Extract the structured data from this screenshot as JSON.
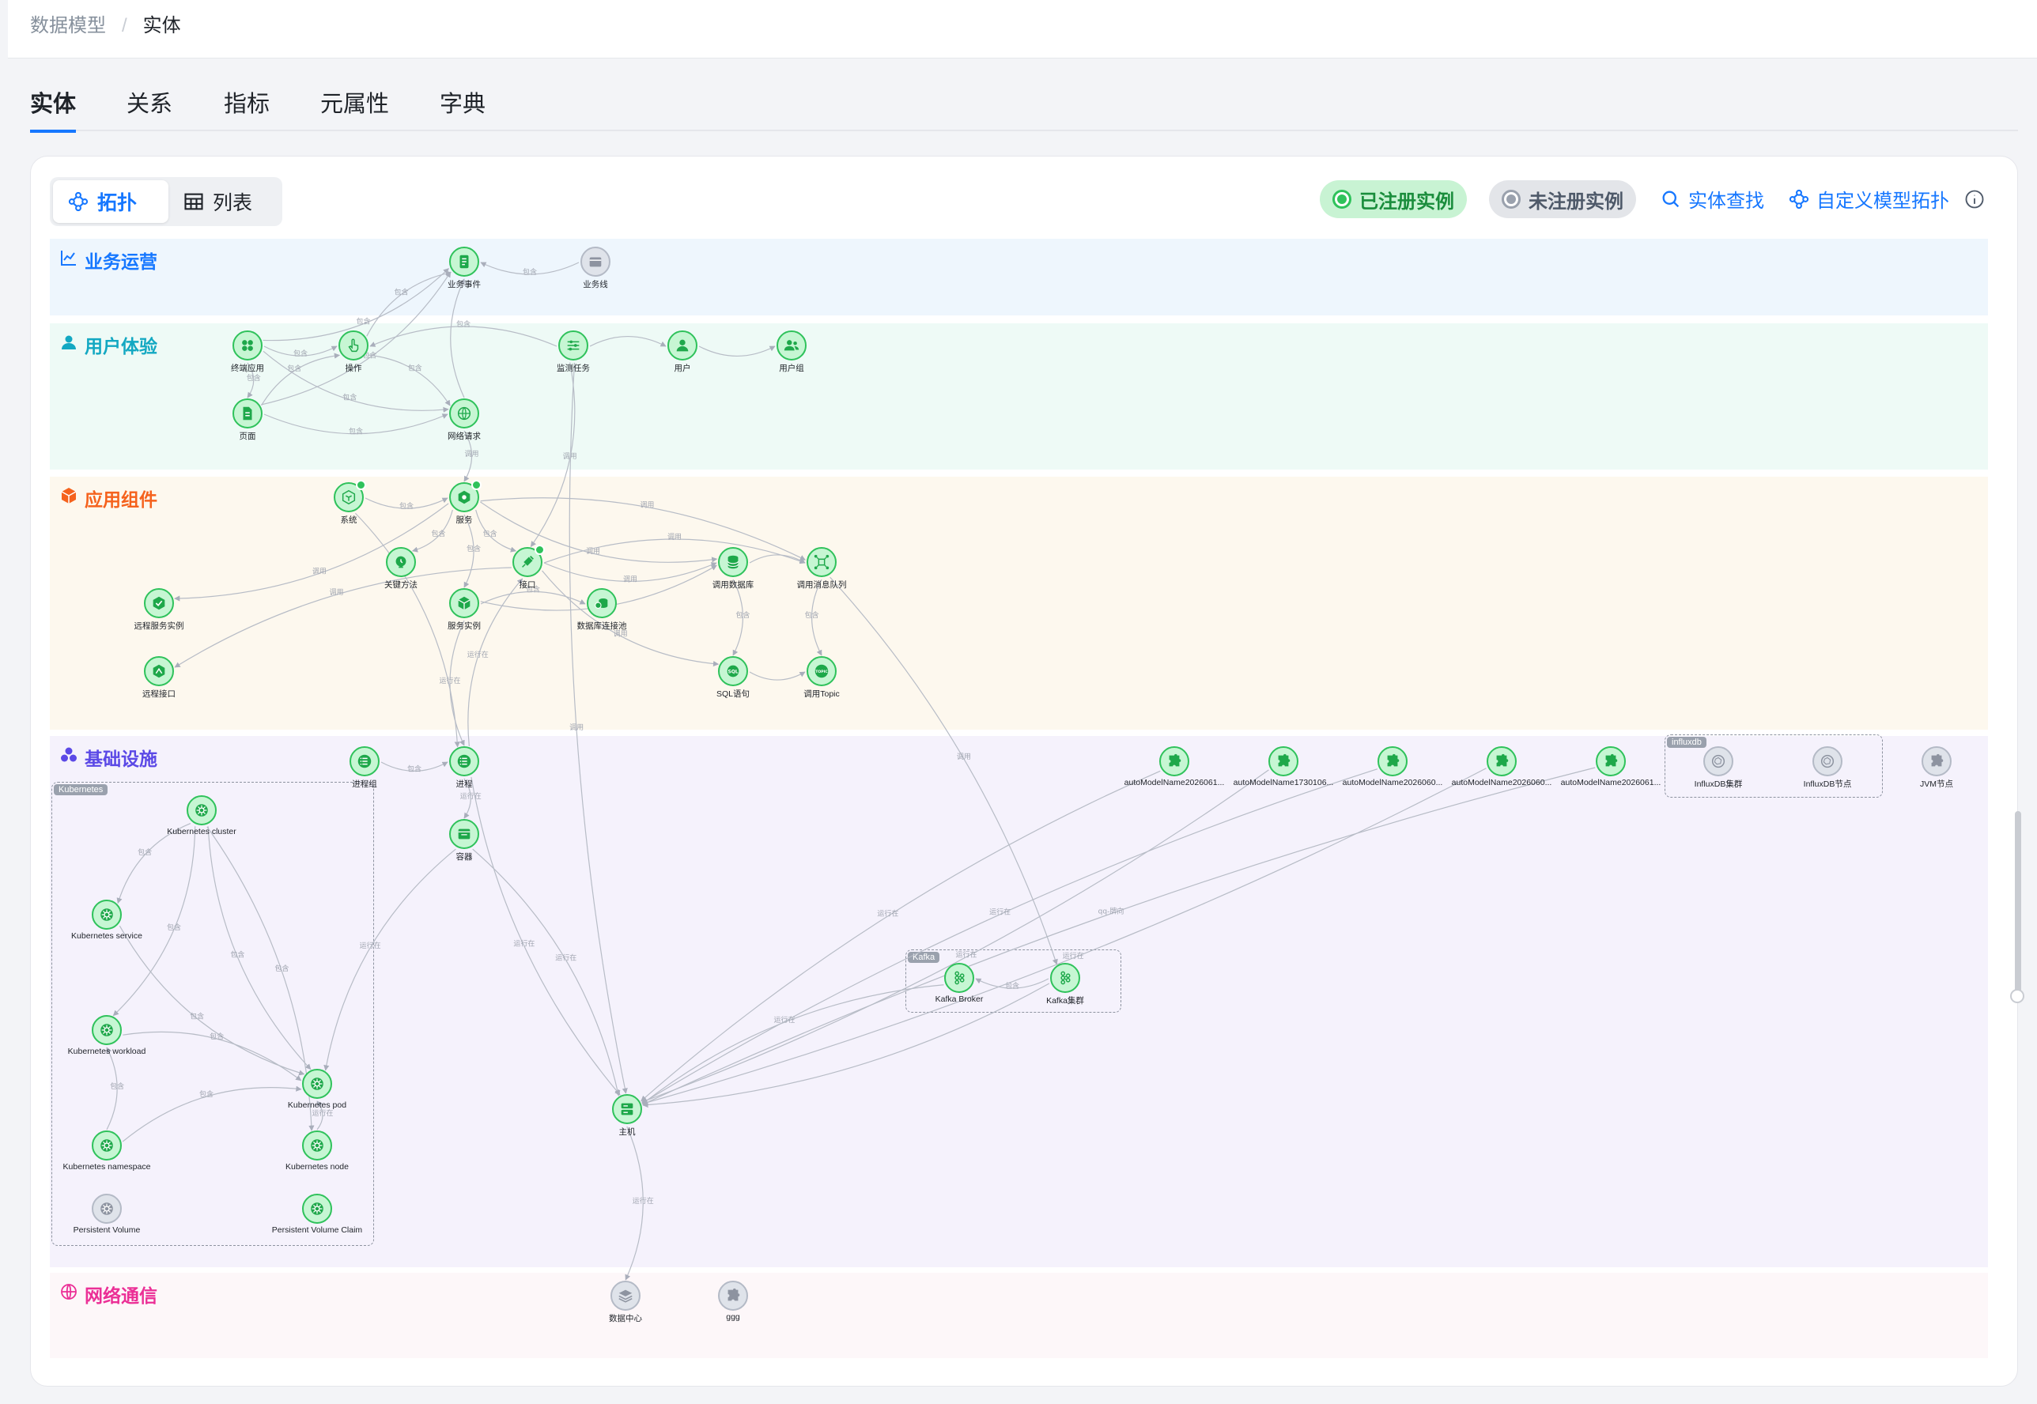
{
  "breadcrumb": {
    "parent": "数据模型",
    "separator": "/",
    "current": "实体"
  },
  "tabs": [
    {
      "label": "实体",
      "active": true
    },
    {
      "label": "关系",
      "active": false
    },
    {
      "label": "指标",
      "active": false
    },
    {
      "label": "元属性",
      "active": false
    },
    {
      "label": "字典",
      "active": false
    }
  ],
  "view_toggle": {
    "topology": "拓扑",
    "list": "列表",
    "selected": "拓扑"
  },
  "toolbar": {
    "registered": "已注册实例",
    "unregistered": "未注册实例",
    "find_entity": "实体查找",
    "custom_topology": "自定义模型拓扑"
  },
  "colors": {
    "accent": "#1677ff",
    "registered": "#2fc25b",
    "unregistered": "#b4bac6"
  },
  "lanes": [
    {
      "id": "biz",
      "title": "业务运营",
      "icon": "chart-line-icon",
      "color": "#1677ff",
      "bg": "#eef6fd"
    },
    {
      "id": "ux",
      "title": "用户体验",
      "icon": "user-icon",
      "color": "#13a8c2",
      "bg": "#eefaf6"
    },
    {
      "id": "app",
      "title": "应用组件",
      "icon": "cube-icon",
      "color": "#f5621d",
      "bg": "#fdf8ee"
    },
    {
      "id": "infra",
      "title": "基础设施",
      "icon": "cluster-icon",
      "color": "#5b49e6",
      "bg": "#f5f2fc"
    },
    {
      "id": "net",
      "title": "网络通信",
      "icon": "globe-icon",
      "color": "#eb2f96",
      "bg": "#fdf7f9"
    }
  ],
  "groups": [
    {
      "id": "k8s",
      "label": "Kubernetes"
    },
    {
      "id": "kafka",
      "label": "Kafka"
    },
    {
      "id": "influx",
      "label": "influxdb"
    }
  ],
  "nodes": [
    {
      "id": "biz_event",
      "label": "业务事件",
      "icon": "doc-icon",
      "status": "registered"
    },
    {
      "id": "biz_line",
      "label": "业务线",
      "icon": "box-icon",
      "status": "unregistered"
    },
    {
      "id": "terminal_app",
      "label": "终端应用",
      "icon": "apps-icon",
      "status": "registered"
    },
    {
      "id": "operation",
      "label": "操作",
      "icon": "hand-icon",
      "status": "registered"
    },
    {
      "id": "monitor_task",
      "label": "监测任务",
      "icon": "sliders-icon",
      "status": "registered"
    },
    {
      "id": "user",
      "label": "用户",
      "icon": "user-icon",
      "status": "registered"
    },
    {
      "id": "user_group",
      "label": "用户组",
      "icon": "users-icon",
      "status": "registered"
    },
    {
      "id": "page",
      "label": "页面",
      "icon": "page-icon",
      "status": "registered"
    },
    {
      "id": "net_request",
      "label": "网络请求",
      "icon": "globe-icon",
      "status": "registered"
    },
    {
      "id": "system",
      "label": "系统",
      "icon": "system-icon",
      "status": "registered",
      "badge": true
    },
    {
      "id": "service",
      "label": "服务",
      "icon": "service-icon",
      "status": "registered",
      "badge": true
    },
    {
      "id": "key_method",
      "label": "关键方法",
      "icon": "method-icon",
      "status": "registered"
    },
    {
      "id": "interface",
      "label": "接口",
      "icon": "plug-icon",
      "status": "registered",
      "badge": true
    },
    {
      "id": "call_db",
      "label": "调用数据库",
      "icon": "db-icon",
      "status": "registered"
    },
    {
      "id": "call_mq",
      "label": "调用消息队列",
      "icon": "mq-icon",
      "status": "registered"
    },
    {
      "id": "remote_service_instance",
      "label": "远程服务实例",
      "icon": "remote-icon",
      "status": "registered"
    },
    {
      "id": "service_instance",
      "label": "服务实例",
      "icon": "cube-icon",
      "status": "registered"
    },
    {
      "id": "db_pool",
      "label": "数据库连接池",
      "icon": "pool-icon",
      "status": "registered"
    },
    {
      "id": "remote_interface",
      "label": "远程接口",
      "icon": "remote-if-icon",
      "status": "registered"
    },
    {
      "id": "sql",
      "label": "SQL语句",
      "icon": "sql-icon",
      "status": "registered"
    },
    {
      "id": "call_topic",
      "label": "调用Topic",
      "icon": "topic-icon",
      "status": "registered"
    },
    {
      "id": "process_group",
      "label": "进程组",
      "icon": "list-icon",
      "status": "registered"
    },
    {
      "id": "process",
      "label": "进程",
      "icon": "list-icon",
      "status": "registered"
    },
    {
      "id": "container",
      "label": "容器",
      "icon": "container-icon",
      "status": "registered"
    },
    {
      "id": "auto1",
      "label": "autoModelName2026061...",
      "icon": "puzzle-icon",
      "status": "registered"
    },
    {
      "id": "auto2",
      "label": "autoModelName1730106...",
      "icon": "puzzle-icon",
      "status": "registered"
    },
    {
      "id": "auto3",
      "label": "autoModelName2026060...",
      "icon": "puzzle-icon",
      "status": "registered"
    },
    {
      "id": "auto4",
      "label": "autoModelName2026060...",
      "icon": "puzzle-icon",
      "status": "registered"
    },
    {
      "id": "auto5",
      "label": "autoModelName2026061...",
      "icon": "puzzle-icon",
      "status": "registered"
    },
    {
      "id": "influx_cluster",
      "label": "InfluxDB集群",
      "icon": "influx-icon",
      "status": "unregistered"
    },
    {
      "id": "influx_node",
      "label": "InfluxDB节点",
      "icon": "influx-icon",
      "status": "unregistered"
    },
    {
      "id": "jvm_node",
      "label": "JVM节点",
      "icon": "puzzle-icon",
      "status": "unregistered"
    },
    {
      "id": "k8s_cluster",
      "label": "Kubernetes cluster",
      "icon": "k8s-icon",
      "status": "registered"
    },
    {
      "id": "k8s_service",
      "label": "Kubernetes service",
      "icon": "k8s-icon",
      "status": "registered"
    },
    {
      "id": "k8s_workload",
      "label": "Kubernetes workload",
      "icon": "k8s-icon",
      "status": "registered"
    },
    {
      "id": "k8s_pod",
      "label": "Kubernetes pod",
      "icon": "k8s-icon",
      "status": "registered"
    },
    {
      "id": "k8s_namespace",
      "label": "Kubernetes namespace",
      "icon": "k8s-icon",
      "status": "registered"
    },
    {
      "id": "k8s_node",
      "label": "Kubernetes node",
      "icon": "k8s-icon",
      "status": "registered"
    },
    {
      "id": "pv",
      "label": "Persistent Volume",
      "icon": "k8s-icon",
      "status": "unregistered"
    },
    {
      "id": "pvc",
      "label": "Persistent Volume Claim",
      "icon": "k8s-icon",
      "status": "registered"
    },
    {
      "id": "kafka_broker",
      "label": "Kafka Broker",
      "icon": "kafka-icon",
      "status": "registered"
    },
    {
      "id": "kafka_cluster",
      "label": "Kafka集群",
      "icon": "kafka-icon",
      "status": "registered"
    },
    {
      "id": "host",
      "label": "主机",
      "icon": "server-icon",
      "status": "registered"
    },
    {
      "id": "datacenter",
      "label": "数据中心",
      "icon": "layers-icon",
      "status": "unregistered"
    },
    {
      "id": "ggg",
      "label": "ggg",
      "icon": "puzzle-icon",
      "status": "unregistered"
    }
  ],
  "edges": [
    {
      "from": "biz_line",
      "to": "biz_event",
      "label": "包含"
    },
    {
      "from": "terminal_app",
      "to": "biz_event",
      "label": "包含"
    },
    {
      "from": "operation",
      "to": "biz_event",
      "label": "包含"
    },
    {
      "from": "page",
      "to": "biz_event",
      "label": "包含"
    },
    {
      "from": "net_request",
      "to": "biz_event",
      "label": ""
    },
    {
      "from": "terminal_app",
      "to": "operation",
      "label": "包含"
    },
    {
      "from": "terminal_app",
      "to": "page",
      "label": "包含"
    },
    {
      "from": "terminal_app",
      "to": "net_request",
      "label": "包含"
    },
    {
      "from": "page",
      "to": "operation",
      "label": "包含"
    },
    {
      "from": "page",
      "to": "net_request",
      "label": "包含"
    },
    {
      "from": "operation",
      "to": "net_request",
      "label": "包含"
    },
    {
      "from": "monitor_task",
      "to": "operation",
      "label": "包含"
    },
    {
      "from": "monitor_task",
      "to": "user",
      "label": ""
    },
    {
      "from": "user",
      "to": "user_group",
      "label": ""
    },
    {
      "from": "monitor_task",
      "to": "interface",
      "label": "调用"
    },
    {
      "from": "monitor_task",
      "to": "host",
      "label": "调用"
    },
    {
      "from": "net_request",
      "to": "service",
      "label": "调用"
    },
    {
      "from": "system",
      "to": "service",
      "label": "包含"
    },
    {
      "from": "service",
      "to": "key_method",
      "label": "包含"
    },
    {
      "from": "service",
      "to": "interface",
      "label": "包含"
    },
    {
      "from": "service",
      "to": "service_instance",
      "label": "包含"
    },
    {
      "from": "service",
      "to": "call_db",
      "label": "调用"
    },
    {
      "from": "service",
      "to": "call_mq",
      "label": "调用"
    },
    {
      "from": "interface",
      "to": "call_db",
      "label": "调用"
    },
    {
      "from": "interface",
      "to": "call_mq",
      "label": "调用"
    },
    {
      "from": "service_instance",
      "to": "call_db",
      "label": "调用"
    },
    {
      "from": "service_instance",
      "to": "db_pool",
      "label": "包含"
    },
    {
      "from": "interface",
      "to": "sql",
      "label": "调用"
    },
    {
      "from": "call_db",
      "to": "sql",
      "label": "包含"
    },
    {
      "from": "call_mq",
      "to": "call_topic",
      "label": "包含"
    },
    {
      "from": "call_db",
      "to": "call_mq",
      "label": ""
    },
    {
      "from": "sql",
      "to": "call_topic",
      "label": ""
    },
    {
      "from": "service",
      "to": "remote_service_instance",
      "label": "调用"
    },
    {
      "from": "interface",
      "to": "remote_interface",
      "label": "调用"
    },
    {
      "from": "system",
      "to": "process",
      "label": ""
    },
    {
      "from": "service_instance",
      "to": "process",
      "label": "运行在"
    },
    {
      "from": "process",
      "to": "interface",
      "label": "运行在"
    },
    {
      "from": "process_group",
      "to": "process",
      "label": "包含"
    },
    {
      "from": "process",
      "to": "container",
      "label": "运行在"
    },
    {
      "from": "process",
      "to": "host",
      "label": "运行在"
    },
    {
      "from": "container",
      "to": "host",
      "label": "运行在"
    },
    {
      "from": "container",
      "to": "k8s_pod",
      "label": "运行在"
    },
    {
      "from": "call_mq",
      "to": "kafka_cluster",
      "label": "调用"
    },
    {
      "from": "k8s_cluster",
      "to": "k8s_service",
      "label": "包含"
    },
    {
      "from": "k8s_cluster",
      "to": "k8s_workload",
      "label": "包含"
    },
    {
      "from": "k8s_cluster",
      "to": "k8s_pod",
      "label": "包含"
    },
    {
      "from": "k8s_cluster",
      "to": "k8s_node",
      "label": "包含"
    },
    {
      "from": "k8s_service",
      "to": "k8s_pod",
      "label": "包含"
    },
    {
      "from": "k8s_workload",
      "to": "k8s_pod",
      "label": "包含"
    },
    {
      "from": "k8s_namespace",
      "to": "k8s_workload",
      "label": "包含"
    },
    {
      "from": "k8s_namespace",
      "to": "k8s_pod",
      "label": "包含"
    },
    {
      "from": "k8s_node",
      "to": "k8s_pod",
      "label": "运行在"
    },
    {
      "from": "kafka_cluster",
      "to": "kafka_broker",
      "label": "包含"
    },
    {
      "from": "kafka_broker",
      "to": "host",
      "label": "运行在"
    },
    {
      "from": "kafka_cluster",
      "to": "host",
      "label": ""
    },
    {
      "from": "auto1",
      "to": "host",
      "label": "运行在"
    },
    {
      "from": "auto2",
      "to": "host",
      "label": "运行在"
    },
    {
      "from": "auto3",
      "to": "host",
      "label": "运行在"
    },
    {
      "from": "auto4",
      "to": "host",
      "label": "运行在"
    },
    {
      "from": "auto5",
      "to": "host",
      "label": "qq-牌向"
    },
    {
      "from": "host",
      "to": "datacenter",
      "label": "运行在"
    }
  ]
}
